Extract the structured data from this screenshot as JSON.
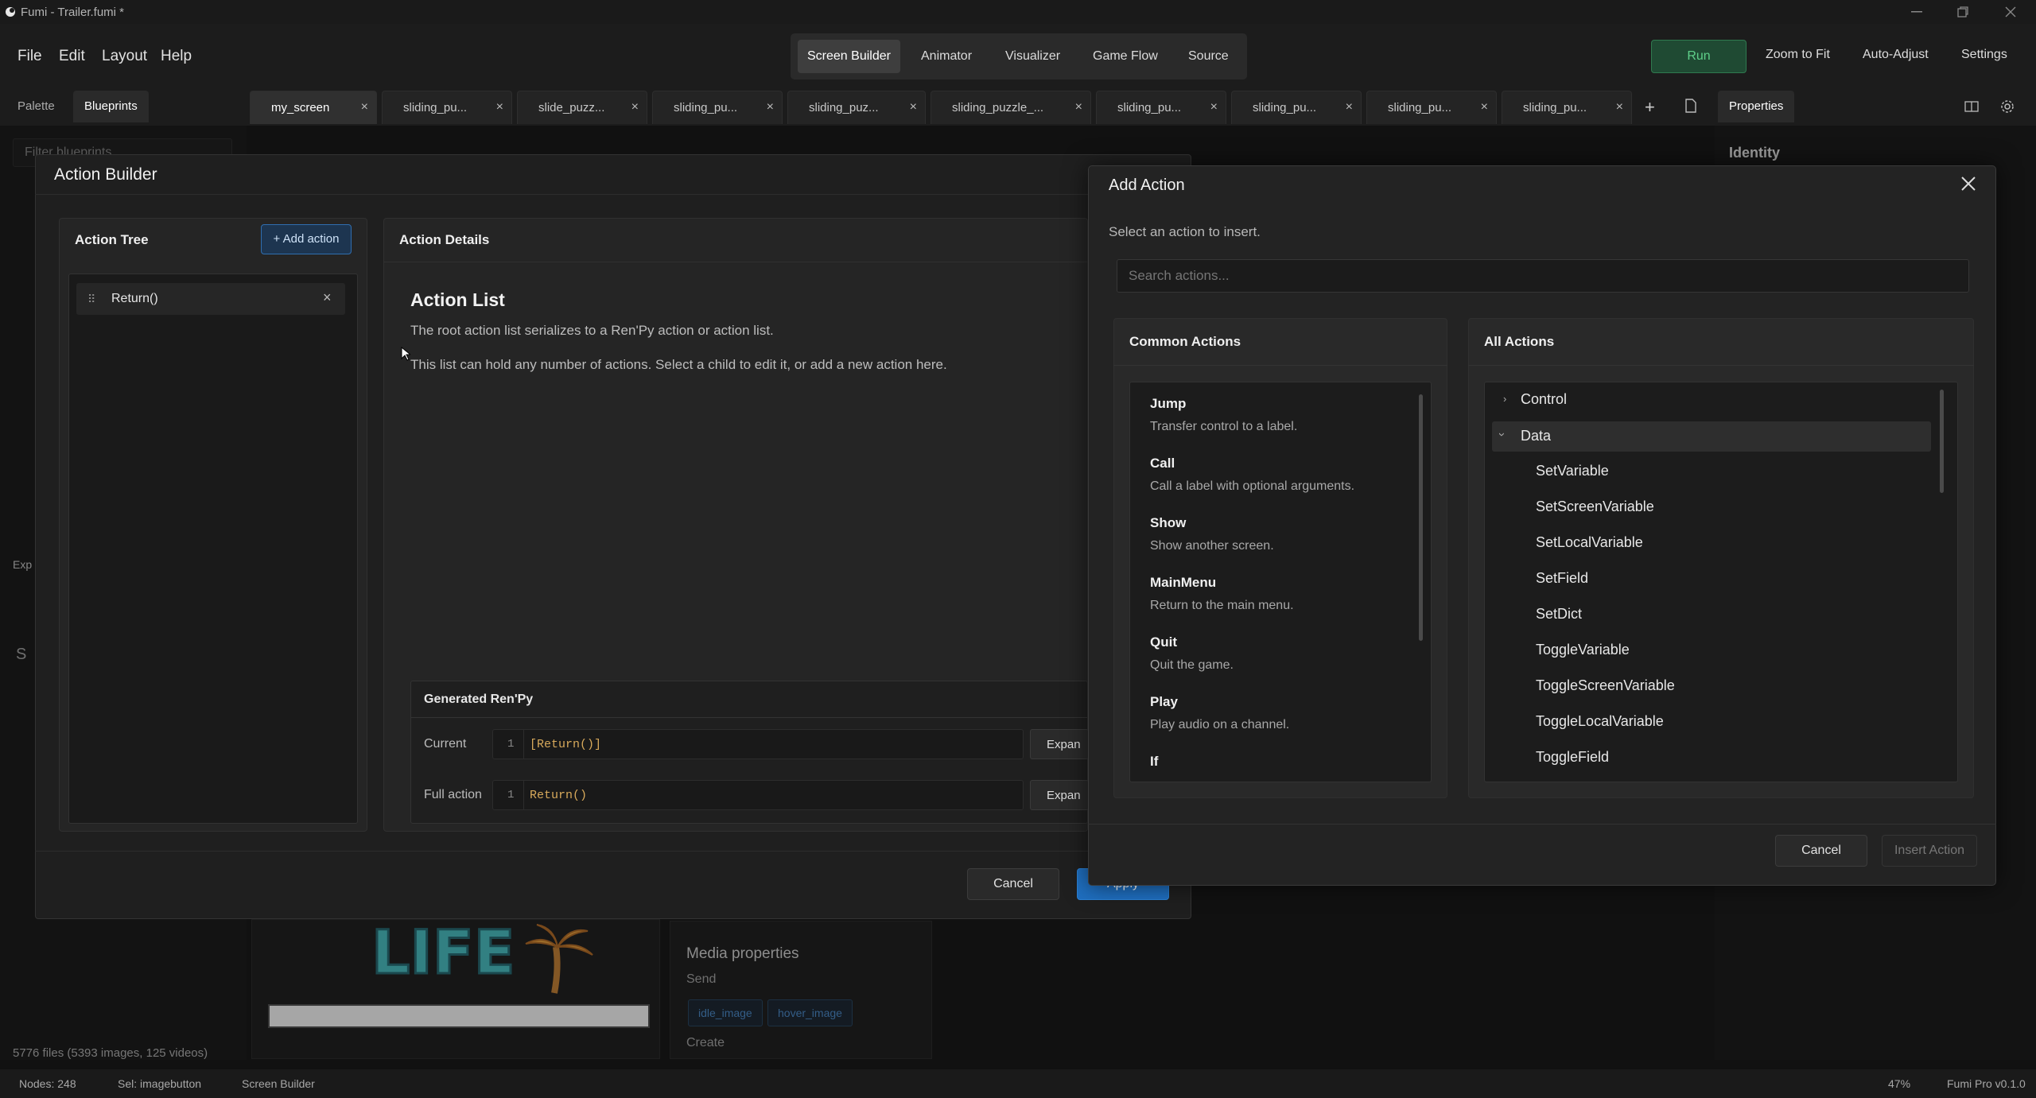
{
  "window": {
    "title": "Fumi - Trailer.fumi *"
  },
  "menu": {
    "file": "File",
    "edit": "Edit",
    "layout": "Layout",
    "help": "Help"
  },
  "modes": {
    "screen_builder": "Screen Builder",
    "animator": "Animator",
    "visualizer": "Visualizer",
    "game_flow": "Game Flow",
    "source": "Source"
  },
  "toolbar": {
    "run": "Run",
    "zoom_to_fit": "Zoom to Fit",
    "auto_adjust": "Auto-Adjust",
    "settings": "Settings"
  },
  "left_tabs": {
    "palette": "Palette",
    "blueprints": "Blueprints"
  },
  "filter": {
    "placeholder": "Filter blueprints..."
  },
  "doc_tabs": [
    {
      "label": "my_screen"
    },
    {
      "label": "sliding_pu..."
    },
    {
      "label": "slide_puzz..."
    },
    {
      "label": "sliding_pu..."
    },
    {
      "label": "sliding_puz..."
    },
    {
      "label": "sliding_puzzle_..."
    },
    {
      "label": "sliding_pu..."
    },
    {
      "label": "sliding_pu..."
    },
    {
      "label": "sliding_pu..."
    },
    {
      "label": "sliding_pu..."
    }
  ],
  "right_tabs": {
    "properties": "Properties",
    "identity": "Identity"
  },
  "background": {
    "exp_label": "Exp",
    "s_label": "S",
    "logo_text": "LIFE",
    "media_title": "Media properties",
    "send": "Send",
    "idle_image": "idle_image",
    "hover_image": "hover_image",
    "create": "Create",
    "file_count": "5776 files (5393 images, 125 videos)"
  },
  "action_builder": {
    "title": "Action Builder",
    "tree_title": "Action Tree",
    "add_action": "+ Add action",
    "tree_items": [
      {
        "label": "Return()"
      }
    ],
    "details_title": "Action Details",
    "list_heading": "Action List",
    "desc1": "The root action list serializes to a Ren'Py action or action list.",
    "desc2": "This list can hold any number of actions. Select a child to edit it, or add a new action here.",
    "generated_title": "Generated Ren'Py",
    "current_label": "Current",
    "current_line": "1",
    "current_code": "[Return()]",
    "full_label": "Full action",
    "full_line": "1",
    "full_code": "Return()",
    "expand": "Expan",
    "cancel": "Cancel",
    "apply": "Apply"
  },
  "add_action": {
    "title": "Add Action",
    "subtitle": "Select an action to insert.",
    "search_placeholder": "Search actions...",
    "common_title": "Common Actions",
    "common": [
      {
        "name": "Jump",
        "desc": "Transfer control to a label."
      },
      {
        "name": "Call",
        "desc": "Call a label with optional arguments."
      },
      {
        "name": "Show",
        "desc": "Show another screen."
      },
      {
        "name": "MainMenu",
        "desc": "Return to the main menu."
      },
      {
        "name": "Quit",
        "desc": "Quit the game."
      },
      {
        "name": "Play",
        "desc": "Play audio on a channel."
      },
      {
        "name": "If",
        "desc": ""
      }
    ],
    "all_title": "All Actions",
    "categories": {
      "control": "Control",
      "data": "Data"
    },
    "data_items": [
      "SetVariable",
      "SetScreenVariable",
      "SetLocalVariable",
      "SetField",
      "SetDict",
      "ToggleVariable",
      "ToggleScreenVariable",
      "ToggleLocalVariable",
      "ToggleField"
    ],
    "cancel": "Cancel",
    "insert": "Insert Action"
  },
  "status": {
    "nodes": "Nodes: 248",
    "selection": "Sel: imagebutton",
    "mode": "Screen Builder",
    "zoom": "47%",
    "version": "Fumi Pro v0.1.0"
  },
  "colors": {
    "accent_blue": "#1f6fc0",
    "run_green": "#2f7a4f",
    "code_orange": "#d7a95b",
    "logo_teal": "#4ec5c8",
    "palm_orange": "#f0a640"
  }
}
